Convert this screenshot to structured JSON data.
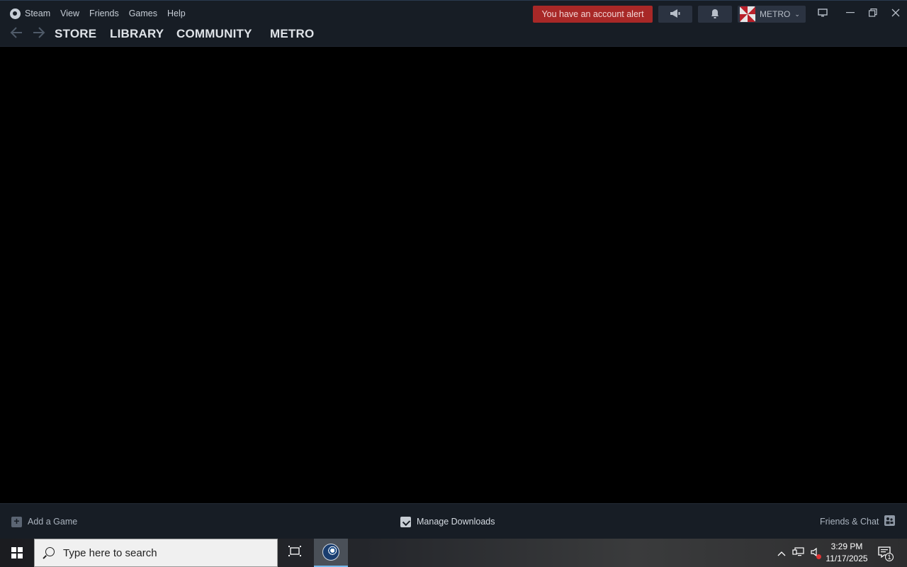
{
  "window": {
    "menu": [
      "Steam",
      "View",
      "Friends",
      "Games",
      "Help"
    ],
    "account_alert": "You have an account alert",
    "account_name": "METRO",
    "icons": {
      "announce": "megaphone-icon",
      "notifications": "bell-icon",
      "big_picture": "monitor-icon",
      "minimize": "minimize-icon",
      "restore": "restore-icon",
      "close": "close-icon"
    },
    "colors": {
      "alert_bg": "#a82827",
      "chrome_bg": "#171d25"
    }
  },
  "nav": {
    "tabs": [
      "STORE",
      "LIBRARY",
      "COMMUNITY",
      "METRO"
    ]
  },
  "footer": {
    "add_game": "Add a Game",
    "manage_downloads": "Manage Downloads",
    "friends_chat": "Friends & Chat"
  },
  "taskbar": {
    "search_placeholder": "Type here to search",
    "time": "3:29 PM",
    "date": "11/17/2025",
    "notification_count": "1"
  }
}
